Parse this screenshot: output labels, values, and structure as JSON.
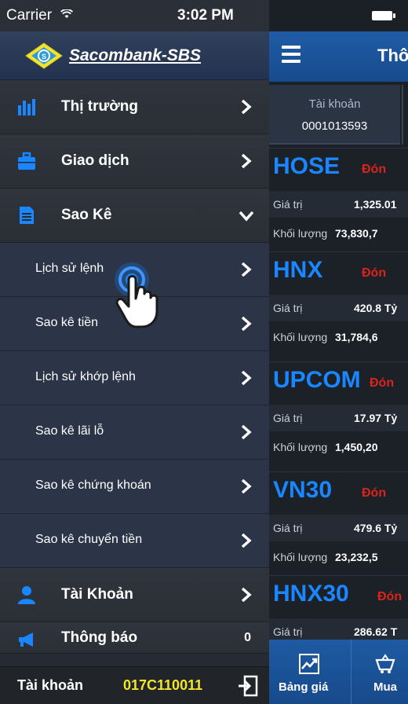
{
  "status": {
    "carrier": "Carrier",
    "time": "3:02 PM"
  },
  "brand": {
    "name": "Sacombank-SBS"
  },
  "menu": {
    "market": {
      "label": "Thị trường"
    },
    "trade": {
      "label": "Giao dịch"
    },
    "statement": {
      "label": "Sao Kê",
      "items": [
        {
          "label": "Lịch sử lệnh"
        },
        {
          "label": "Sao kê tiền"
        },
        {
          "label": "Lịch sử khớp lệnh"
        },
        {
          "label": "Sao kê lãi lỗ"
        },
        {
          "label": "Sao kê chứng khoán"
        },
        {
          "label": "Sao kê chuyển tiền"
        }
      ]
    },
    "account": {
      "label": "Tài Khoản"
    },
    "notifications": {
      "label": "Thông báo",
      "count": "0"
    }
  },
  "bottombar": {
    "label": "Tài khoản",
    "value": "017C110011"
  },
  "main": {
    "title": "Thô",
    "account": {
      "label": "Tài khoản",
      "value": "0001013593"
    },
    "markets": [
      {
        "name": "HOSE",
        "status": "Đón",
        "value_label": "Giá trị",
        "value": "1,325.01",
        "volume_label": "Khối lượng",
        "volume": "73,830,7"
      },
      {
        "name": "HNX",
        "status": "Đón",
        "value_label": "Giá trị",
        "value": "420.8 Tỷ",
        "volume_label": "Khối lượng",
        "volume": "31,784,6"
      },
      {
        "name": "UPCOM",
        "status": "Đón",
        "value_label": "Giá trị",
        "value": "17.97 Tỷ",
        "volume_label": "Khối lượng",
        "volume": "1,450,20"
      },
      {
        "name": "VN30",
        "status": "Đón",
        "value_label": "Giá trị",
        "value": "479.6 Tỷ",
        "volume_label": "Khối lượng",
        "volume": "23,232,5"
      },
      {
        "name": "HNX30",
        "status": "Đón",
        "value_label": "Giá trị",
        "value": "286.62 T"
      }
    ],
    "tabs": [
      {
        "label": "Bảng giá"
      },
      {
        "label": "Mua"
      }
    ]
  },
  "colors": {
    "accent_blue": "#1a86ff",
    "status_red": "#d9241c",
    "account_yellow": "#f2e52c"
  }
}
